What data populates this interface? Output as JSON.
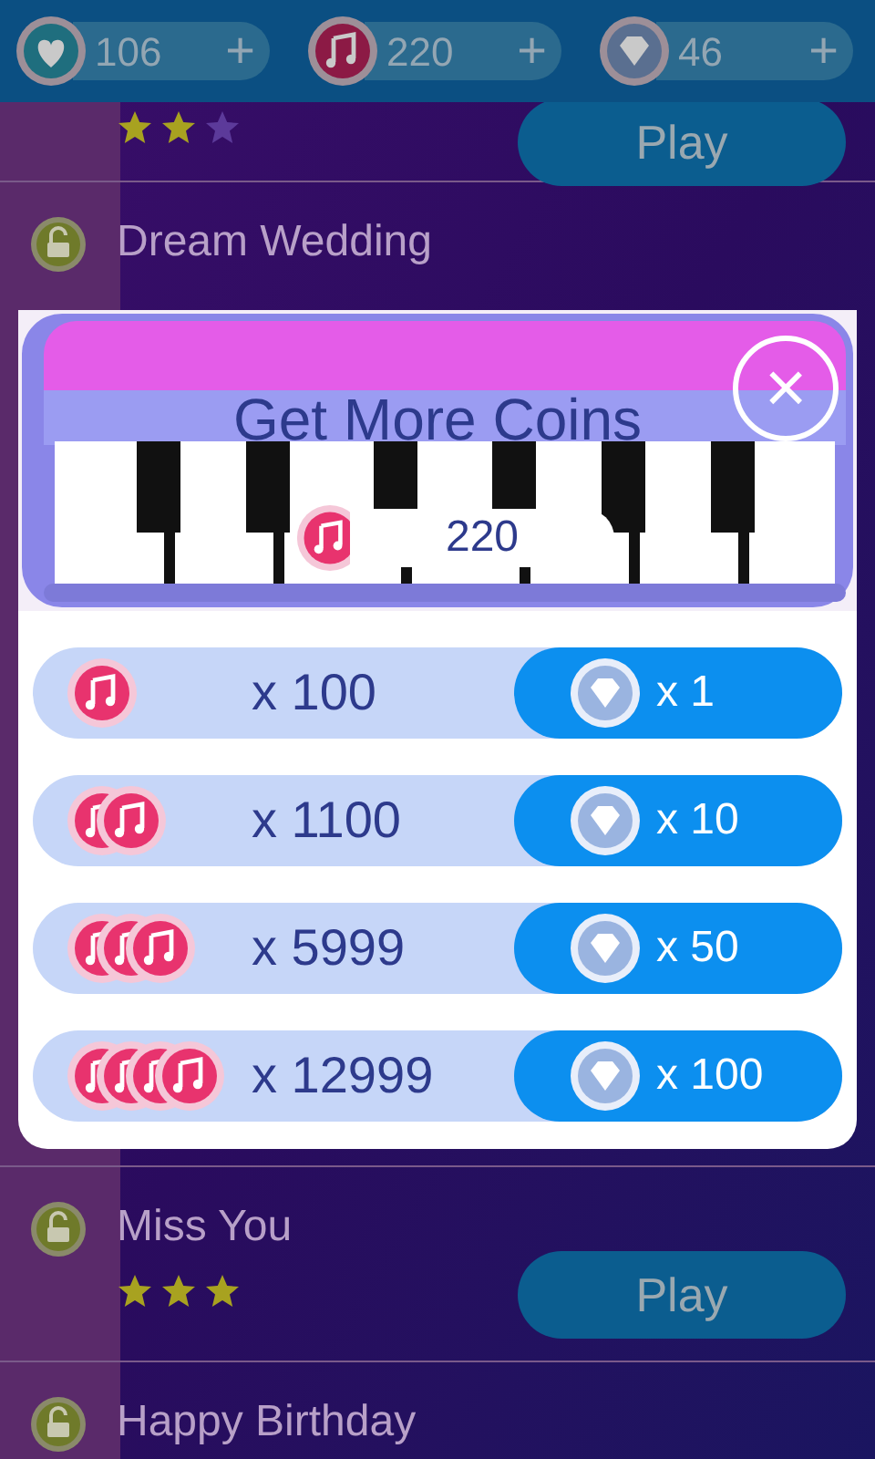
{
  "top_bar": [
    {
      "kind": "heart",
      "value": "106",
      "add": "+"
    },
    {
      "kind": "note",
      "value": "220",
      "add": "+"
    },
    {
      "kind": "diamond",
      "value": "46",
      "add": "+"
    }
  ],
  "songs": [
    {
      "stars": 2,
      "play": "Play"
    },
    {
      "title": "Dream Wedding"
    },
    {
      "title": "Miss You",
      "stars": 3,
      "play": "Play"
    },
    {
      "title": "Happy Birthday"
    }
  ],
  "dialog": {
    "title": "Get More Coins",
    "close": "×",
    "balance": "220",
    "offers": [
      {
        "coins": "x 100",
        "price": "x 1"
      },
      {
        "coins": "x 1100",
        "price": "x 10"
      },
      {
        "coins": "x 5999",
        "price": "x 50"
      },
      {
        "coins": "x 12999",
        "price": "x 100"
      }
    ]
  }
}
